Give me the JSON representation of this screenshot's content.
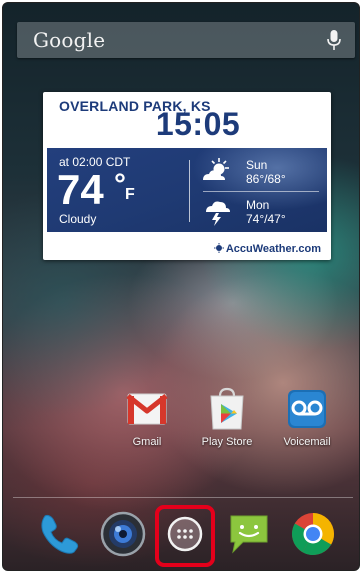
{
  "search": {
    "label": "Google",
    "icon": "microphone-icon"
  },
  "weather": {
    "location": "OVERLAND PARK, KS",
    "time": "15:05",
    "observed_at": "at 02:00 CDT",
    "temperature": "74",
    "degree_symbol": "°",
    "unit": "F",
    "condition": "Cloudy",
    "forecast": [
      {
        "day": "Sun",
        "temps": "86°/68°",
        "icon": "sun-cloud-icon"
      },
      {
        "day": "Mon",
        "temps": "74°/47°",
        "icon": "thunderstorm-icon"
      }
    ],
    "brand": "AccuWeather.com",
    "colors": {
      "panel": "#1f3a73",
      "text_blue": "#1d3b7a"
    }
  },
  "apps": [
    {
      "label": "Gmail",
      "icon": "gmail-icon"
    },
    {
      "label": "Play Store",
      "icon": "play-store-icon"
    },
    {
      "label": "Voicemail",
      "icon": "voicemail-icon"
    }
  ],
  "dock": [
    {
      "name": "phone",
      "icon": "phone-icon"
    },
    {
      "name": "camera",
      "icon": "camera-icon"
    },
    {
      "name": "app-launcher",
      "icon": "apps-grid-icon",
      "highlighted": true
    },
    {
      "name": "messaging",
      "icon": "messaging-icon"
    },
    {
      "name": "chrome",
      "icon": "chrome-icon"
    }
  ],
  "colors": {
    "highlight": "#e4001b"
  }
}
